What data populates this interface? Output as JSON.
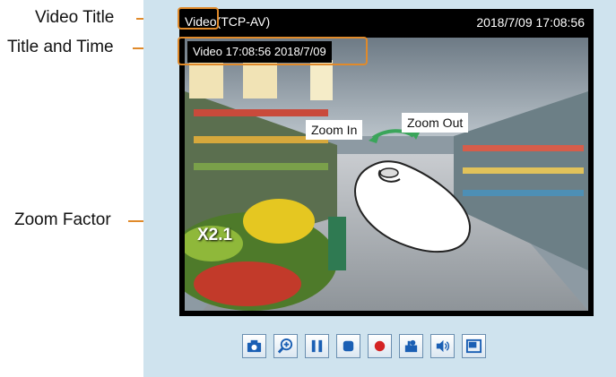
{
  "callouts": {
    "video_title": "Video Title",
    "title_and_time": "Title and Time",
    "zoom_factor": "Zoom Factor"
  },
  "viewer": {
    "title": "Video(TCP-AV)",
    "date_time": "2018/7/09  17:08:56",
    "overlay_title_time": "Video 17:08:56  2018/7/09",
    "zoom_factor": "X2.1",
    "zoom_in_label": "Zoom In",
    "zoom_out_label": "Zoom Out"
  },
  "controls": [
    {
      "icon": "camera-icon"
    },
    {
      "icon": "zoom-icon"
    },
    {
      "icon": "pause-icon"
    },
    {
      "icon": "stop-icon"
    },
    {
      "icon": "record-icon"
    },
    {
      "icon": "manual-trigger-icon"
    },
    {
      "icon": "speaker-icon"
    },
    {
      "icon": "fullscreen-icon"
    }
  ],
  "colors": {
    "accent": "#e08a2a",
    "panel": "#cfe3ee",
    "button_icon": "#1a5fb4"
  }
}
